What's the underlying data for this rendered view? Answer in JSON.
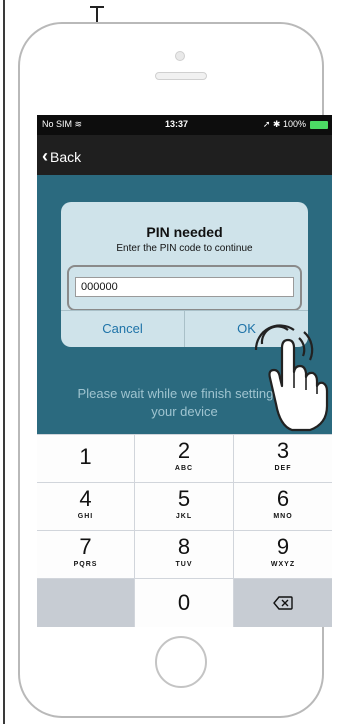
{
  "status_bar": {
    "carrier": "No SIM",
    "time": "13:37",
    "battery": "100%"
  },
  "nav": {
    "back_label": "Back"
  },
  "alert": {
    "title": "PIN needed",
    "message": "Enter the PIN code to continue",
    "pin_value": "000000",
    "cancel_label": "Cancel",
    "ok_label": "OK"
  },
  "background_text": {
    "line1": "Please wait while we finish setting up",
    "line2": "your device"
  },
  "keypad": [
    {
      "num": "1",
      "letters": ""
    },
    {
      "num": "2",
      "letters": "ABC"
    },
    {
      "num": "3",
      "letters": "DEF"
    },
    {
      "num": "4",
      "letters": "GHI"
    },
    {
      "num": "5",
      "letters": "JKL"
    },
    {
      "num": "6",
      "letters": "MNO"
    },
    {
      "num": "7",
      "letters": "PQRS"
    },
    {
      "num": "8",
      "letters": "TUV"
    },
    {
      "num": "9",
      "letters": "WXYZ"
    },
    {
      "num": "",
      "letters": ""
    },
    {
      "num": "0",
      "letters": ""
    },
    {
      "num": "",
      "letters": ""
    }
  ],
  "colors": {
    "screen_bg": "#2c5e72",
    "alert_bg": "#cfe3ea",
    "button_blue": "#1e73a8",
    "battery_green": "#4cd964"
  },
  "icons": {
    "back": "chevron-left-icon",
    "wifi": "wifi-icon",
    "location": "location-arrow-icon",
    "bluetooth": "bluetooth-icon",
    "battery": "battery-icon",
    "delete": "backspace-icon",
    "tap": "hand-tap-icon"
  }
}
